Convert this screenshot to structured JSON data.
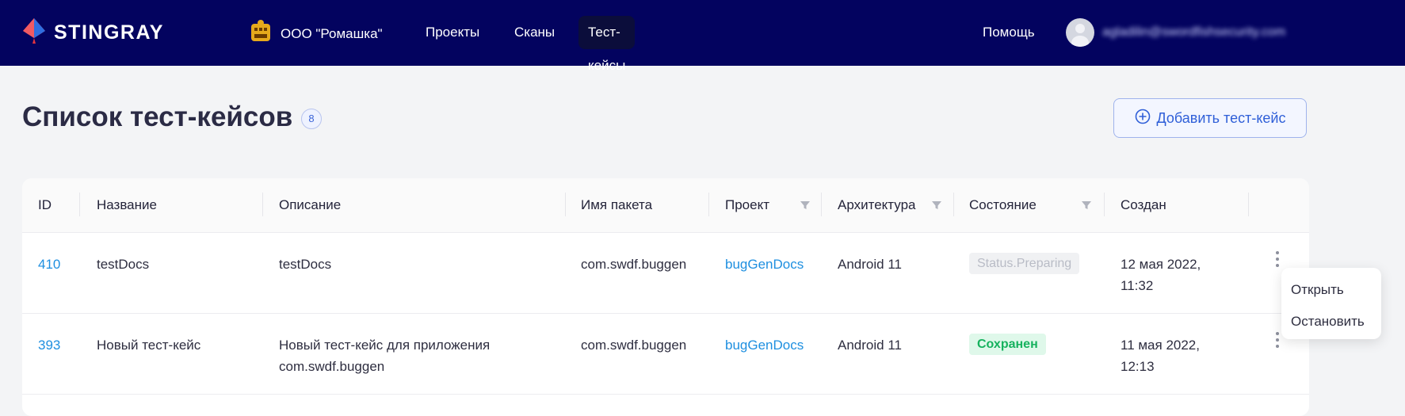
{
  "brand": {
    "name": "STINGRAY"
  },
  "org": {
    "label": "ООО \"Ромашка\""
  },
  "nav": {
    "items": [
      {
        "label": "Проекты"
      },
      {
        "label": "Сканы"
      },
      {
        "label": "Тест-кейсы",
        "active": true
      }
    ],
    "help": "Помощь"
  },
  "user": {
    "email": "agladilin@swordfishsecurity.com"
  },
  "page": {
    "title": "Список тест-кейсов",
    "count": "8",
    "add_button": "Добавить тест-кейс"
  },
  "table": {
    "columns": [
      "ID",
      "Название",
      "Описание",
      "Имя пакета",
      "Проект",
      "Архитектура",
      "Состояние",
      "Создан"
    ],
    "rows": [
      {
        "id": "410",
        "name": "testDocs",
        "description": [
          "testDocs"
        ],
        "package": "com.swdf.buggen",
        "project": "bugGenDocs",
        "architecture": "Android 11",
        "status": "Status.Preparing",
        "created": [
          "12 мая 2022,",
          "11:32"
        ]
      },
      {
        "id": "393",
        "name": "Новый тест-кейс",
        "description": [
          "Новый тест-кейс для приложения",
          "com.swdf.buggen"
        ],
        "package": "com.swdf.buggen",
        "project": "bugGenDocs",
        "architecture": "Android 11",
        "status": "Сохранен",
        "created": [
          "11 мая 2022,",
          "12:13"
        ]
      }
    ]
  },
  "menu": {
    "items": [
      "Открыть",
      "Остановить"
    ]
  },
  "colors": {
    "topbar": "#03035f",
    "accent": "#2f5fd8",
    "link": "#1e8fe0",
    "status_saved": "#16b25e"
  }
}
